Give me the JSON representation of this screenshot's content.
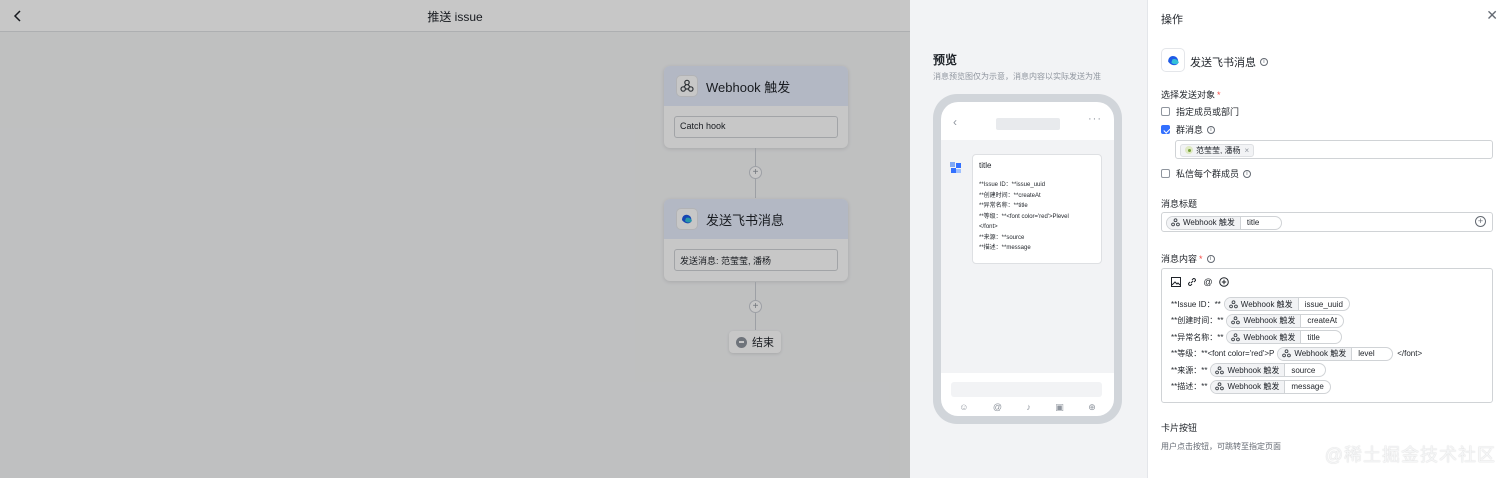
{
  "canvas": {
    "title": "推送 issue",
    "trigger_node": {
      "title": "Webhook 触发",
      "field": "Catch hook"
    },
    "action_node": {
      "title": "发送飞书消息",
      "field": "发送消息: 范莹莹, 潘杨"
    },
    "add_symbol": "+",
    "end_label": "结束"
  },
  "preview": {
    "title": "预览",
    "hint": "消息预览图仅为示意，消息内容以实际发送为准",
    "card": {
      "title": "title",
      "lines": [
        "**Issue ID：**issue_uuid",
        "**创建时间：**createAt",
        "**异常名称：**title",
        "**等级：**<font color='red'>Plevel",
        "</font>",
        "**来源：**source",
        "**描述：**message"
      ]
    },
    "back_glyph": "‹",
    "more_glyph": "···"
  },
  "ops": {
    "title": "操作",
    "close_glyph": "✕",
    "action_name": "发送飞书消息",
    "target_label": "选择发送对象",
    "required_mark": "*",
    "options": {
      "members": {
        "label": "指定成员或部门",
        "checked": false
      },
      "group": {
        "label": "群消息",
        "checked": true
      },
      "private": {
        "label": "私信每个群成员",
        "checked": false
      }
    },
    "group_tag": "范莹莹, 潘杨",
    "tag_close": "×",
    "msg_title_label": "消息标题",
    "msg_title_var": {
      "source": "Webhook 触发",
      "field": "title"
    },
    "msg_content_label": "消息内容",
    "content_lines": [
      {
        "pre": "**Issue ID：**",
        "source": "Webhook 触发",
        "field": "issue_uuid",
        "post": ""
      },
      {
        "pre": "**创建时间：**",
        "source": "Webhook 触发",
        "field": "createAt",
        "post": ""
      },
      {
        "pre": "**异常名称：**",
        "source": "Webhook 触发",
        "field": "title",
        "post": ""
      },
      {
        "pre": "**等级：**<font color='red'>P",
        "source": "Webhook 触发",
        "field": "level",
        "post": "</font>"
      },
      {
        "pre": "**来源：**",
        "source": "Webhook 触发",
        "field": "source",
        "post": ""
      },
      {
        "pre": "**描述：**",
        "source": "Webhook 触发",
        "field": "message",
        "post": ""
      }
    ],
    "card_button_label": "卡片按钮",
    "card_button_hint": "用户点击按钮，可跳转至指定页面",
    "watermark": "@稀土掘金技术社区"
  },
  "colors": {
    "accent": "#3370ff",
    "required": "#f54a45",
    "node_header": "#e6ecfb"
  },
  "icons": [
    "chevron-left-icon",
    "webhook-icon",
    "feishu-icon",
    "stop-icon",
    "info-icon",
    "image-icon",
    "link-icon",
    "at-icon",
    "plus-circle-icon",
    "close-icon"
  ]
}
